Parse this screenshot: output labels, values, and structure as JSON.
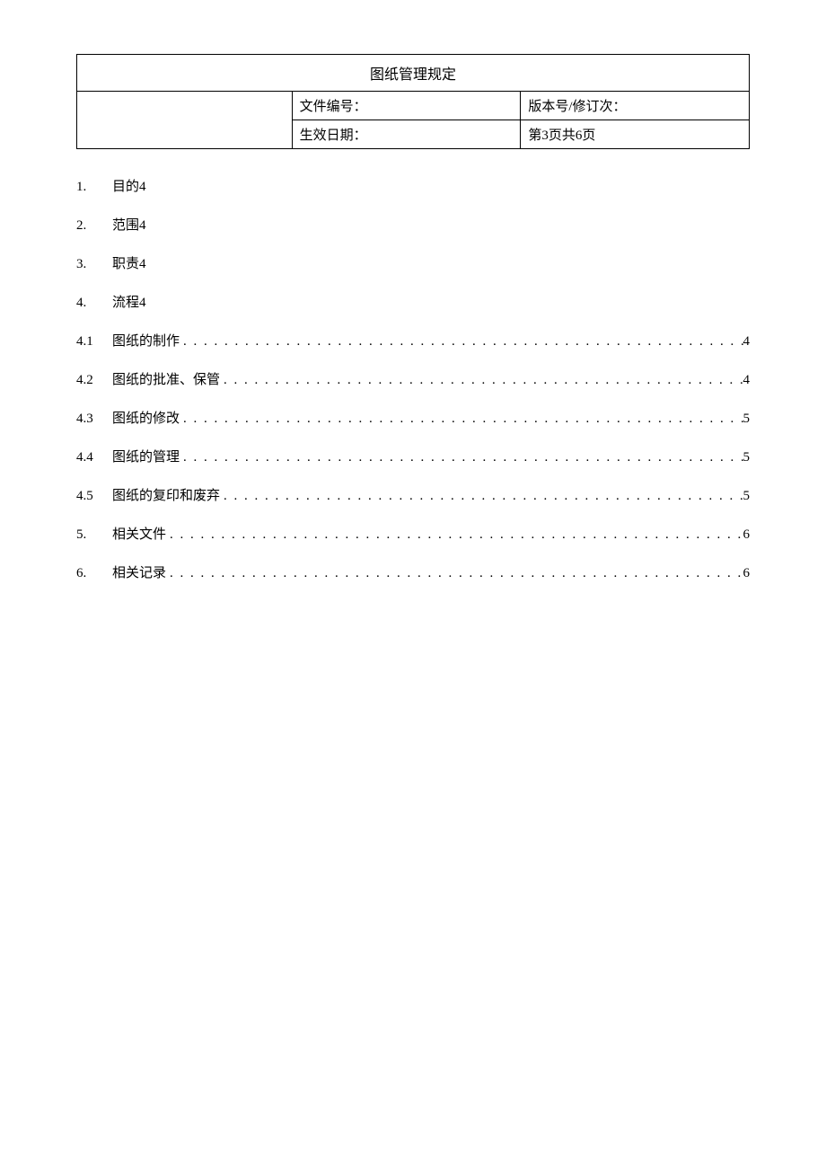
{
  "header": {
    "title": "图纸管理规定",
    "docNumberLabel": "文件编号：",
    "versionLabel": "版本号/修订次：",
    "effectiveDateLabel": "生效日期：",
    "pageInfo": "第3页共6页"
  },
  "toc": {
    "items": [
      {
        "num": "1.",
        "text": "目的4",
        "page": "",
        "leader": false
      },
      {
        "num": "2.",
        "text": "范围4",
        "page": "",
        "leader": false
      },
      {
        "num": "3.",
        "text": "职责4",
        "page": "",
        "leader": false
      },
      {
        "num": "4.",
        "text": "流程4",
        "page": "",
        "leader": false
      },
      {
        "num": "4.1",
        "text": "图纸的制作",
        "page": "4",
        "leader": true
      },
      {
        "num": "4.2",
        "text": "图纸的批准、保管",
        "page": "4",
        "leader": true
      },
      {
        "num": "4.3",
        "text": "图纸的修改",
        "page": "5",
        "leader": true
      },
      {
        "num": "4.4",
        "text": "图纸的管理",
        "page": "5",
        "leader": true
      },
      {
        "num": "4.5",
        "text": "图纸的复印和废弃",
        "page": "5",
        "leader": true
      },
      {
        "num": "5.",
        "text": "相关文件",
        "page": "6",
        "leader": true
      },
      {
        "num": "6.",
        "text": "相关记录",
        "page": "6",
        "leader": true
      }
    ],
    "leaderDots": ". . . . . . . . . . . . . . . . . . . . . . . . . . . . . . . . . . . . . . . . . . . . . . . . . . . . . . . . . . . . . . . . . . . . . . . . . . . . . . . . . . . . . . . . . . . . . . . . . . . . . . . . . . . . . . . . . . . . . . . . . . . . . ."
  }
}
